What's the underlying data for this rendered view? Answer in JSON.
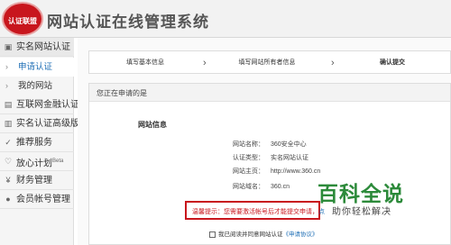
{
  "header": {
    "logo_text": "认证联盟",
    "title": "网站认证在线管理系统"
  },
  "sidebar": {
    "items": [
      {
        "label": "实名网站认证",
        "icon": "shield-icon"
      },
      {
        "label": "互联网金融认证",
        "icon": "bank-icon"
      },
      {
        "label": "实名认证高级版",
        "icon": "id-card-icon"
      },
      {
        "label": "推荐服务",
        "icon": "thumbs-up-icon"
      },
      {
        "label": "放心计划",
        "icon": "heart-shield-icon",
        "badge": "Beta"
      },
      {
        "label": "财务管理",
        "icon": "yen-icon"
      },
      {
        "label": "会员帐号管理",
        "icon": "user-icon"
      }
    ],
    "subitems": [
      {
        "label": "申请认证",
        "icon": "chevron-right-icon"
      },
      {
        "label": "我的网站",
        "icon": "chevron-right-icon"
      }
    ]
  },
  "steps": [
    {
      "label": "填写基本信息"
    },
    {
      "label": "填写网站所有者信息"
    },
    {
      "label": "确认提交"
    }
  ],
  "panel": {
    "title": "您正在申请的是",
    "section_title": "网站信息",
    "fields": [
      {
        "key": "网站名称：",
        "value": "360安全中心"
      },
      {
        "key": "认证类型：",
        "value": "实名网站认证"
      },
      {
        "key": "网站主页：",
        "value": "http://www.360.cn"
      },
      {
        "key": "网站域名：",
        "value": "360.cn"
      }
    ]
  },
  "notice": {
    "prefix": "温馨提示：",
    "text": "您需要激活帐号后才能提交申请，",
    "link": "点"
  },
  "agreement": {
    "text": "我已阅读并同意网站认证",
    "link": "《申请协议》"
  },
  "watermark": {
    "main": "百科全说",
    "sub": "助你轻松解决"
  }
}
